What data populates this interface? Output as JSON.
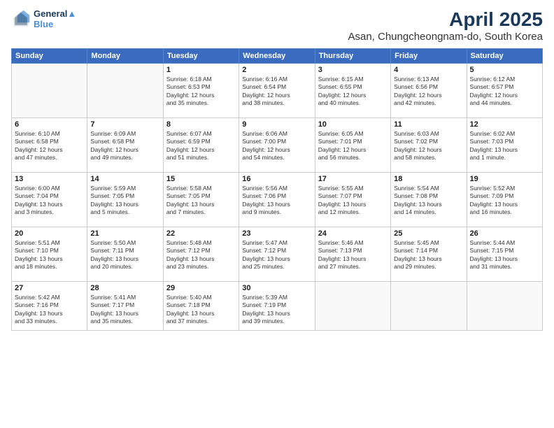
{
  "logo": {
    "line1": "General",
    "line2": "Blue"
  },
  "title": "April 2025",
  "subtitle": "Asan, Chungcheongnam-do, South Korea",
  "days_header": [
    "Sunday",
    "Monday",
    "Tuesday",
    "Wednesday",
    "Thursday",
    "Friday",
    "Saturday"
  ],
  "weeks": [
    [
      {
        "num": "",
        "info": ""
      },
      {
        "num": "",
        "info": ""
      },
      {
        "num": "1",
        "info": "Sunrise: 6:18 AM\nSunset: 6:53 PM\nDaylight: 12 hours\nand 35 minutes."
      },
      {
        "num": "2",
        "info": "Sunrise: 6:16 AM\nSunset: 6:54 PM\nDaylight: 12 hours\nand 38 minutes."
      },
      {
        "num": "3",
        "info": "Sunrise: 6:15 AM\nSunset: 6:55 PM\nDaylight: 12 hours\nand 40 minutes."
      },
      {
        "num": "4",
        "info": "Sunrise: 6:13 AM\nSunset: 6:56 PM\nDaylight: 12 hours\nand 42 minutes."
      },
      {
        "num": "5",
        "info": "Sunrise: 6:12 AM\nSunset: 6:57 PM\nDaylight: 12 hours\nand 44 minutes."
      }
    ],
    [
      {
        "num": "6",
        "info": "Sunrise: 6:10 AM\nSunset: 6:58 PM\nDaylight: 12 hours\nand 47 minutes."
      },
      {
        "num": "7",
        "info": "Sunrise: 6:09 AM\nSunset: 6:58 PM\nDaylight: 12 hours\nand 49 minutes."
      },
      {
        "num": "8",
        "info": "Sunrise: 6:07 AM\nSunset: 6:59 PM\nDaylight: 12 hours\nand 51 minutes."
      },
      {
        "num": "9",
        "info": "Sunrise: 6:06 AM\nSunset: 7:00 PM\nDaylight: 12 hours\nand 54 minutes."
      },
      {
        "num": "10",
        "info": "Sunrise: 6:05 AM\nSunset: 7:01 PM\nDaylight: 12 hours\nand 56 minutes."
      },
      {
        "num": "11",
        "info": "Sunrise: 6:03 AM\nSunset: 7:02 PM\nDaylight: 12 hours\nand 58 minutes."
      },
      {
        "num": "12",
        "info": "Sunrise: 6:02 AM\nSunset: 7:03 PM\nDaylight: 13 hours\nand 1 minute."
      }
    ],
    [
      {
        "num": "13",
        "info": "Sunrise: 6:00 AM\nSunset: 7:04 PM\nDaylight: 13 hours\nand 3 minutes."
      },
      {
        "num": "14",
        "info": "Sunrise: 5:59 AM\nSunset: 7:05 PM\nDaylight: 13 hours\nand 5 minutes."
      },
      {
        "num": "15",
        "info": "Sunrise: 5:58 AM\nSunset: 7:05 PM\nDaylight: 13 hours\nand 7 minutes."
      },
      {
        "num": "16",
        "info": "Sunrise: 5:56 AM\nSunset: 7:06 PM\nDaylight: 13 hours\nand 9 minutes."
      },
      {
        "num": "17",
        "info": "Sunrise: 5:55 AM\nSunset: 7:07 PM\nDaylight: 13 hours\nand 12 minutes."
      },
      {
        "num": "18",
        "info": "Sunrise: 5:54 AM\nSunset: 7:08 PM\nDaylight: 13 hours\nand 14 minutes."
      },
      {
        "num": "19",
        "info": "Sunrise: 5:52 AM\nSunset: 7:09 PM\nDaylight: 13 hours\nand 16 minutes."
      }
    ],
    [
      {
        "num": "20",
        "info": "Sunrise: 5:51 AM\nSunset: 7:10 PM\nDaylight: 13 hours\nand 18 minutes."
      },
      {
        "num": "21",
        "info": "Sunrise: 5:50 AM\nSunset: 7:11 PM\nDaylight: 13 hours\nand 20 minutes."
      },
      {
        "num": "22",
        "info": "Sunrise: 5:48 AM\nSunset: 7:12 PM\nDaylight: 13 hours\nand 23 minutes."
      },
      {
        "num": "23",
        "info": "Sunrise: 5:47 AM\nSunset: 7:12 PM\nDaylight: 13 hours\nand 25 minutes."
      },
      {
        "num": "24",
        "info": "Sunrise: 5:46 AM\nSunset: 7:13 PM\nDaylight: 13 hours\nand 27 minutes."
      },
      {
        "num": "25",
        "info": "Sunrise: 5:45 AM\nSunset: 7:14 PM\nDaylight: 13 hours\nand 29 minutes."
      },
      {
        "num": "26",
        "info": "Sunrise: 5:44 AM\nSunset: 7:15 PM\nDaylight: 13 hours\nand 31 minutes."
      }
    ],
    [
      {
        "num": "27",
        "info": "Sunrise: 5:42 AM\nSunset: 7:16 PM\nDaylight: 13 hours\nand 33 minutes."
      },
      {
        "num": "28",
        "info": "Sunrise: 5:41 AM\nSunset: 7:17 PM\nDaylight: 13 hours\nand 35 minutes."
      },
      {
        "num": "29",
        "info": "Sunrise: 5:40 AM\nSunset: 7:18 PM\nDaylight: 13 hours\nand 37 minutes."
      },
      {
        "num": "30",
        "info": "Sunrise: 5:39 AM\nSunset: 7:19 PM\nDaylight: 13 hours\nand 39 minutes."
      },
      {
        "num": "",
        "info": ""
      },
      {
        "num": "",
        "info": ""
      },
      {
        "num": "",
        "info": ""
      }
    ]
  ]
}
